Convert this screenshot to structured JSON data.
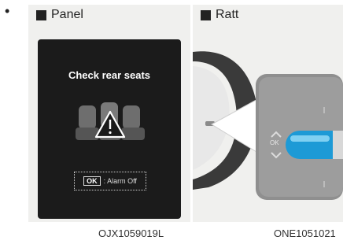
{
  "bullet": "•",
  "panels": {
    "left": {
      "title": "Panel",
      "message": "Check rear seats",
      "ok_key": "OK",
      "ok_label": ": Alarm Off",
      "code": "OJX1059019L"
    },
    "right": {
      "title": "Ratt",
      "button_label": "OK",
      "code": "ONE1051021"
    }
  }
}
